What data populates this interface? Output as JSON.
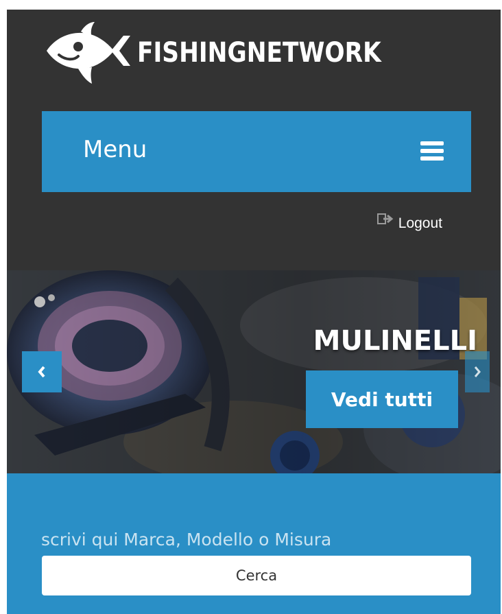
{
  "header": {
    "logo_text": "FISHINGNETWORK",
    "menu_label": "Menu",
    "logout_label": "Logout",
    "menu_icon": "hamburger-icon",
    "logout_icon": "sign-out-icon",
    "logo_icon": "fish-icon"
  },
  "slider": {
    "title": "MULINELLI",
    "cta_label": "Vedi tutti",
    "prev_icon": "chevron-left-icon",
    "next_icon": "chevron-right-icon"
  },
  "search": {
    "placeholder": "scrivi qui Marca, Modello o Misura",
    "button_label": "Cerca"
  },
  "colors": {
    "header_bg": "#333333",
    "accent": "#2a8fc6",
    "white": "#ffffff"
  }
}
